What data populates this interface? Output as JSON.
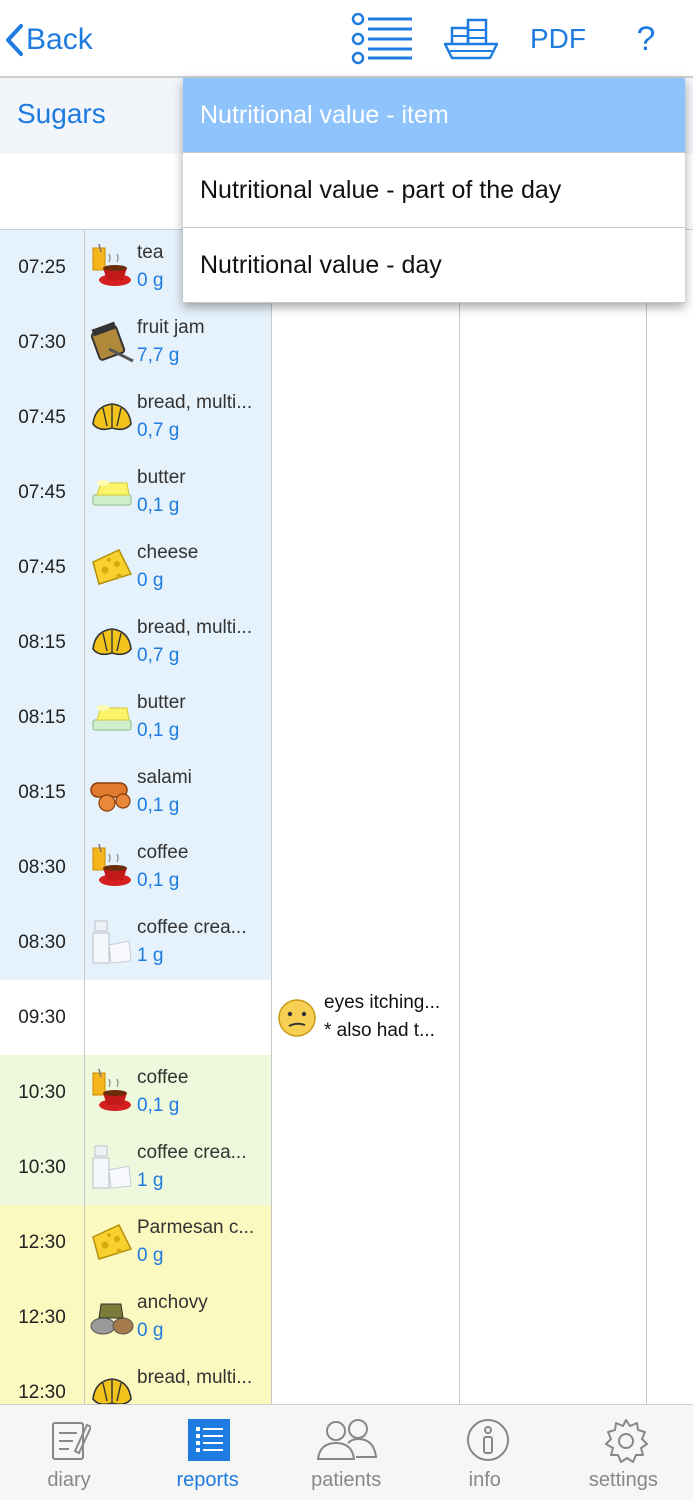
{
  "topbar": {
    "back_label": "Back",
    "pdf_label": "PDF",
    "help_label": "?",
    "icons": [
      "list-icon",
      "ship-icon"
    ]
  },
  "header": {
    "column_title": "Sugars"
  },
  "dropdown": {
    "items": [
      {
        "label": "Nutritional value - item",
        "selected": true
      },
      {
        "label": "Nutritional value - part of the day",
        "selected": false
      },
      {
        "label": "Nutritional value - day",
        "selected": false
      }
    ]
  },
  "rows": [
    {
      "time": "07:25",
      "food": "tea",
      "value": "0 g",
      "icon": "drink-icon",
      "group": "blue"
    },
    {
      "time": "07:30",
      "food": "fruit jam",
      "value": "7,7 g",
      "icon": "jam-icon",
      "group": "blue"
    },
    {
      "time": "07:45",
      "food": "bread, multi...",
      "value": "0,7 g",
      "icon": "bread-icon",
      "group": "blue"
    },
    {
      "time": "07:45",
      "food": "butter",
      "value": "0,1 g",
      "icon": "butter-icon",
      "group": "blue"
    },
    {
      "time": "07:45",
      "food": "cheese",
      "value": "0 g",
      "icon": "cheese-icon",
      "group": "blue"
    },
    {
      "time": "08:15",
      "food": "bread, multi...",
      "value": "0,7 g",
      "icon": "bread-icon",
      "group": "blue"
    },
    {
      "time": "08:15",
      "food": "butter",
      "value": "0,1 g",
      "icon": "butter-icon",
      "group": "blue"
    },
    {
      "time": "08:15",
      "food": "salami",
      "value": "0,1 g",
      "icon": "sausage-icon",
      "group": "blue"
    },
    {
      "time": "08:30",
      "food": "coffee",
      "value": "0,1 g",
      "icon": "drink-icon",
      "group": "blue"
    },
    {
      "time": "08:30",
      "food": "coffee crea...",
      "value": "1 g",
      "icon": "milk-icon",
      "group": "blue"
    },
    {
      "time": "09:30",
      "food": "",
      "value": "",
      "icon": "",
      "group": "white",
      "note_line1": "eyes itching...",
      "note_line2": "* also had t...",
      "mood_icon": "confused-face-icon"
    },
    {
      "time": "10:30",
      "food": "coffee",
      "value": "0,1 g",
      "icon": "drink-icon",
      "group": "green"
    },
    {
      "time": "10:30",
      "food": "coffee crea...",
      "value": "1 g",
      "icon": "milk-icon",
      "group": "green"
    },
    {
      "time": "12:30",
      "food": "Parmesan c...",
      "value": "0 g",
      "icon": "cheese-icon",
      "group": "yellow"
    },
    {
      "time": "12:30",
      "food": "anchovy",
      "value": "0 g",
      "icon": "fish-icon",
      "group": "yellow"
    },
    {
      "time": "12:30",
      "food": "bread, multi...",
      "value": "",
      "icon": "bread-icon",
      "group": "yellow"
    }
  ],
  "tabs": [
    {
      "label": "diary",
      "icon": "diary-icon",
      "active": false
    },
    {
      "label": "reports",
      "icon": "reports-icon",
      "active": true
    },
    {
      "label": "patients",
      "icon": "patients-icon",
      "active": false
    },
    {
      "label": "info",
      "icon": "info-icon",
      "active": false
    },
    {
      "label": "settings",
      "icon": "gear-icon",
      "active": false
    }
  ],
  "colors": {
    "accent": "#1e7be0",
    "selected_menu": "#8ec3fb",
    "breakfast_bg": "#e5f1fb",
    "snack_bg": "#eef8dc",
    "lunch_bg": "#fbf9c0"
  }
}
